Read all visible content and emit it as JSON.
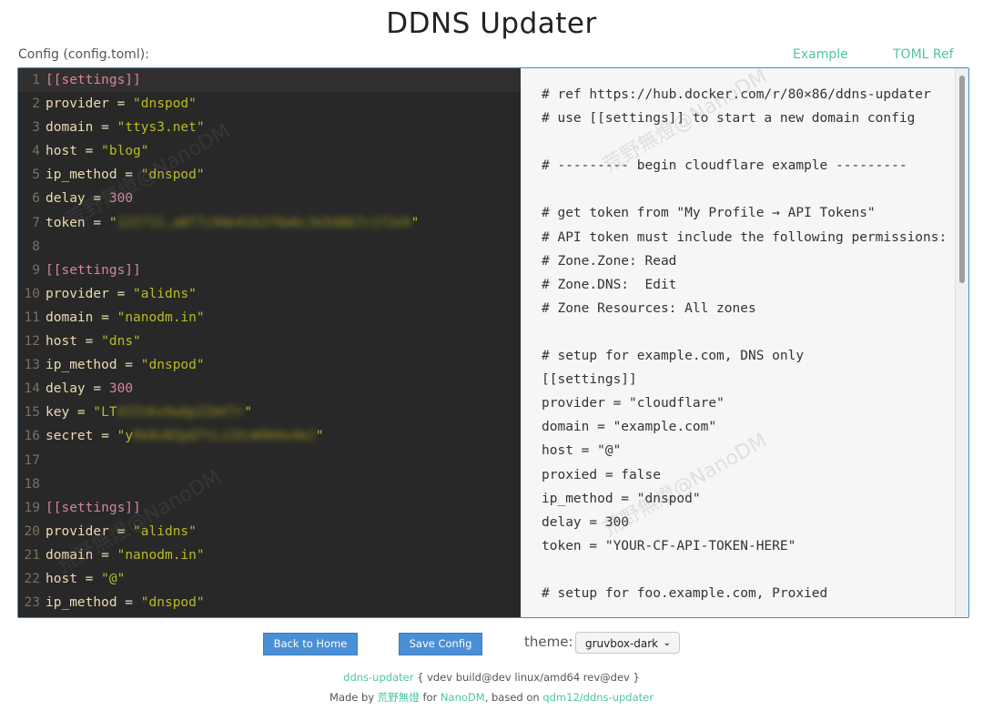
{
  "page": {
    "title": "DDNS Updater",
    "config_label": "Config (config.toml):",
    "link_example": "Example",
    "link_toml_ref": "TOML Ref"
  },
  "editor": {
    "lines": [
      [
        {
          "t": "section",
          "v": "[[settings]]"
        }
      ],
      [
        {
          "t": "key",
          "v": "provider"
        },
        {
          "t": "op",
          "v": " = "
        },
        {
          "t": "str",
          "v": "\"dnspod\""
        }
      ],
      [
        {
          "t": "key",
          "v": "domain"
        },
        {
          "t": "op",
          "v": " = "
        },
        {
          "t": "str",
          "v": "\"ttys3.net\""
        }
      ],
      [
        {
          "t": "key",
          "v": "host"
        },
        {
          "t": "op",
          "v": " = "
        },
        {
          "t": "str",
          "v": "\"blog\""
        }
      ],
      [
        {
          "t": "key",
          "v": "ip_method"
        },
        {
          "t": "op",
          "v": " = "
        },
        {
          "t": "str",
          "v": "\"dnspod\""
        }
      ],
      [
        {
          "t": "key",
          "v": "delay"
        },
        {
          "t": "op",
          "v": " = "
        },
        {
          "t": "num",
          "v": "300"
        }
      ],
      [
        {
          "t": "key",
          "v": "token"
        },
        {
          "t": "op",
          "v": " = "
        },
        {
          "t": "str",
          "v": "\""
        },
        {
          "t": "secret",
          "v": "121711,a8f7c9de41b2f0a6c3e5d8b7c1f2e9"
        },
        {
          "t": "str",
          "v": "\""
        }
      ],
      [],
      [
        {
          "t": "section",
          "v": "[[settings]]"
        }
      ],
      [
        {
          "t": "key",
          "v": "provider"
        },
        {
          "t": "op",
          "v": " = "
        },
        {
          "t": "str",
          "v": "\"alidns\""
        }
      ],
      [
        {
          "t": "key",
          "v": "domain"
        },
        {
          "t": "op",
          "v": " = "
        },
        {
          "t": "str",
          "v": "\"nanodm.in\""
        }
      ],
      [
        {
          "t": "key",
          "v": "host"
        },
        {
          "t": "op",
          "v": " = "
        },
        {
          "t": "str",
          "v": "\"dns\""
        }
      ],
      [
        {
          "t": "key",
          "v": "ip_method"
        },
        {
          "t": "op",
          "v": " = "
        },
        {
          "t": "str",
          "v": "\"dnspod\""
        }
      ],
      [
        {
          "t": "key",
          "v": "delay"
        },
        {
          "t": "op",
          "v": " = "
        },
        {
          "t": "num",
          "v": "300"
        }
      ],
      [
        {
          "t": "key",
          "v": "key"
        },
        {
          "t": "op",
          "v": " = "
        },
        {
          "t": "str",
          "v": "\"LT"
        },
        {
          "t": "secret",
          "v": "AI5tKx9wQp2ZmV7r"
        },
        {
          "t": "str",
          "v": "\""
        }
      ],
      [
        {
          "t": "key",
          "v": "secret"
        },
        {
          "t": "op",
          "v": " = "
        },
        {
          "t": "str",
          "v": "\"y"
        },
        {
          "t": "secret",
          "v": "Rk8vN3pQ7tLz2XcW9bHs4mJ"
        },
        {
          "t": "str",
          "v": "\""
        }
      ],
      [],
      [],
      [
        {
          "t": "section",
          "v": "[[settings]]"
        }
      ],
      [
        {
          "t": "key",
          "v": "provider"
        },
        {
          "t": "op",
          "v": " = "
        },
        {
          "t": "str",
          "v": "\"alidns\""
        }
      ],
      [
        {
          "t": "key",
          "v": "domain"
        },
        {
          "t": "op",
          "v": " = "
        },
        {
          "t": "str",
          "v": "\"nanodm.in\""
        }
      ],
      [
        {
          "t": "key",
          "v": "host"
        },
        {
          "t": "op",
          "v": " = "
        },
        {
          "t": "str",
          "v": "\"@\""
        }
      ],
      [
        {
          "t": "key",
          "v": "ip_method"
        },
        {
          "t": "op",
          "v": " = "
        },
        {
          "t": "str",
          "v": "\"dnspod\""
        }
      ]
    ]
  },
  "example": {
    "lines": [
      "# ref https://hub.docker.com/r/80×86/ddns-updater",
      "# use [[settings]] to start a new domain config",
      "",
      "# --------- begin cloudflare example ---------",
      "",
      "# get token from \"My Profile → API Tokens\"",
      "# API token must include the following permissions:",
      "# Zone.Zone: Read",
      "# Zone.DNS:  Edit",
      "# Zone Resources: All zones",
      "",
      "# setup for example.com, DNS only",
      "[[settings]]",
      "provider = \"cloudflare\"",
      "domain = \"example.com\"",
      "host = \"@\"",
      "proxied = false",
      "ip_method = \"dnspod\"",
      "delay = 300",
      "token = \"YOUR-CF-API-TOKEN-HERE\"",
      "",
      "# setup for foo.example.com, Proxied"
    ]
  },
  "watermark": "荒野無燈@NanoDM",
  "controls": {
    "back_home": "Back to Home",
    "save_config": "Save Config",
    "theme_label": "theme:",
    "theme_value": "gruvbox-dark"
  },
  "footer": {
    "app_link": "ddns-updater",
    "version_text": " { vdev build@dev linux/amd64 rev@dev }",
    "made_by": "Made by ",
    "author": "荒野無燈",
    "for_text": " for ",
    "org": "NanoDM",
    "based_on": ", based on ",
    "upstream": "qdm12/ddns-updater"
  },
  "colors": {
    "editor_bg": "#282828",
    "accent_link": "#4fc4a6",
    "button_blue": "#4a8fd6",
    "frame_border": "#3a8fd6"
  }
}
